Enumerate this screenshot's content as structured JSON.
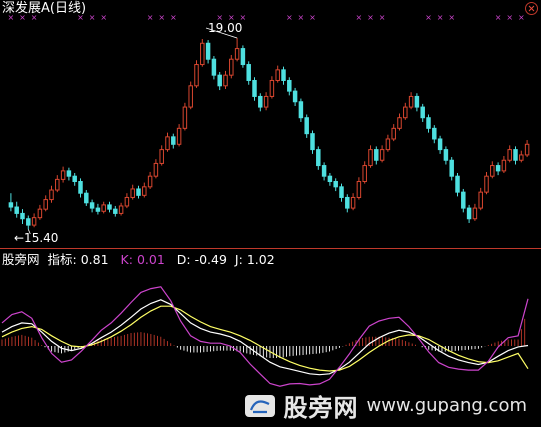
{
  "header": {
    "symbol": "深发展A",
    "period": "(日线)",
    "high_label": "19.00",
    "low_label": "←15.40"
  },
  "indicator": {
    "name": "股旁网",
    "metric_label": "指标:",
    "metric_value": "0.81",
    "k_label": "K:",
    "k_value": "0.01",
    "d_label": "D:",
    "d_value": "-0.49",
    "j_label": "J:",
    "j_value": "1.02"
  },
  "watermark": {
    "cn": "股旁网",
    "url": "www.gupang.com"
  },
  "colors": {
    "up": "#d8462f",
    "down": "#4fe0e0",
    "k_line": "#ffffff",
    "d_line": "#ffff66",
    "j_line": "#cc44cc",
    "marker": "#cc44cc",
    "divider": "#c0392b"
  },
  "chart_data": [
    {
      "type": "candlestick",
      "title": "深发展A (日线)",
      "ylim": [
        15.2,
        19.3
      ],
      "annotations": [
        {
          "label": "19.00",
          "index": 39,
          "value": 19.0
        },
        {
          "label": "←15.40",
          "index": 3,
          "value": 15.4
        }
      ],
      "candles": [
        [
          15.9,
          15.82,
          16.08,
          15.74
        ],
        [
          15.82,
          15.7,
          15.92,
          15.62
        ],
        [
          15.7,
          15.6,
          15.78,
          15.5
        ],
        [
          15.6,
          15.48,
          15.66,
          15.4
        ],
        [
          15.48,
          15.62,
          15.7,
          15.44
        ],
        [
          15.62,
          15.78,
          15.86,
          15.58
        ],
        [
          15.78,
          15.96,
          16.04,
          15.74
        ],
        [
          15.96,
          16.14,
          16.22,
          15.9
        ],
        [
          16.14,
          16.34,
          16.42,
          16.1
        ],
        [
          16.34,
          16.5,
          16.58,
          16.28
        ],
        [
          16.5,
          16.4,
          16.56,
          16.32
        ],
        [
          16.4,
          16.3,
          16.46,
          16.22
        ],
        [
          16.3,
          16.08,
          16.36,
          16.0
        ],
        [
          16.08,
          15.9,
          16.14,
          15.84
        ],
        [
          15.9,
          15.8,
          15.96,
          15.72
        ],
        [
          15.8,
          15.74,
          15.88,
          15.68
        ],
        [
          15.74,
          15.86,
          15.92,
          15.7
        ],
        [
          15.86,
          15.78,
          15.92,
          15.72
        ],
        [
          15.78,
          15.7,
          15.84,
          15.64
        ],
        [
          15.7,
          15.84,
          15.9,
          15.66
        ],
        [
          15.84,
          16.0,
          16.08,
          15.8
        ],
        [
          16.0,
          16.16,
          16.24,
          15.96
        ],
        [
          16.16,
          16.04,
          16.22,
          15.98
        ],
        [
          16.04,
          16.2,
          16.28,
          16.0
        ],
        [
          16.2,
          16.4,
          16.48,
          16.16
        ],
        [
          16.4,
          16.64,
          16.72,
          16.36
        ],
        [
          16.64,
          16.9,
          16.98,
          16.6
        ],
        [
          16.9,
          17.14,
          17.22,
          16.86
        ],
        [
          17.14,
          17.0,
          17.2,
          16.92
        ],
        [
          17.0,
          17.3,
          17.38,
          16.96
        ],
        [
          17.3,
          17.7,
          17.78,
          17.26
        ],
        [
          17.7,
          18.1,
          18.18,
          17.66
        ],
        [
          18.1,
          18.5,
          18.58,
          18.06
        ],
        [
          18.5,
          18.9,
          18.98,
          18.46
        ],
        [
          18.9,
          18.6,
          18.96,
          18.52
        ],
        [
          18.6,
          18.3,
          18.66,
          18.22
        ],
        [
          18.3,
          18.1,
          18.36,
          18.02
        ],
        [
          18.1,
          18.3,
          18.38,
          18.04
        ],
        [
          18.3,
          18.6,
          18.68,
          18.24
        ],
        [
          18.6,
          18.8,
          19.0,
          18.56
        ],
        [
          18.8,
          18.5,
          18.86,
          18.44
        ],
        [
          18.5,
          18.2,
          18.56,
          18.12
        ],
        [
          18.2,
          17.9,
          18.26,
          17.82
        ],
        [
          17.9,
          17.7,
          17.96,
          17.62
        ],
        [
          17.7,
          17.9,
          17.98,
          17.64
        ],
        [
          17.9,
          18.2,
          18.28,
          17.86
        ],
        [
          18.2,
          18.4,
          18.48,
          18.16
        ],
        [
          18.4,
          18.2,
          18.46,
          18.12
        ],
        [
          18.2,
          18.0,
          18.26,
          17.92
        ],
        [
          18.0,
          17.8,
          18.06,
          17.72
        ],
        [
          17.8,
          17.5,
          17.86,
          17.42
        ],
        [
          17.5,
          17.2,
          17.56,
          17.12
        ],
        [
          17.2,
          16.9,
          17.26,
          16.82
        ],
        [
          16.9,
          16.6,
          16.96,
          16.52
        ],
        [
          16.6,
          16.4,
          16.66,
          16.32
        ],
        [
          16.4,
          16.3,
          16.46,
          16.22
        ],
        [
          16.3,
          16.2,
          16.36,
          16.12
        ],
        [
          16.2,
          16.0,
          16.26,
          15.92
        ],
        [
          16.0,
          15.8,
          16.06,
          15.72
        ],
        [
          15.8,
          16.0,
          16.08,
          15.76
        ],
        [
          16.0,
          16.3,
          16.38,
          15.96
        ],
        [
          16.3,
          16.6,
          16.68,
          16.26
        ],
        [
          16.6,
          16.9,
          16.98,
          16.56
        ],
        [
          16.9,
          16.7,
          16.96,
          16.62
        ],
        [
          16.7,
          16.9,
          16.98,
          16.66
        ],
        [
          16.9,
          17.1,
          17.18,
          16.86
        ],
        [
          17.1,
          17.3,
          17.38,
          17.06
        ],
        [
          17.3,
          17.5,
          17.58,
          17.26
        ],
        [
          17.5,
          17.7,
          17.78,
          17.46
        ],
        [
          17.7,
          17.9,
          17.98,
          17.66
        ],
        [
          17.9,
          17.7,
          17.96,
          17.62
        ],
        [
          17.7,
          17.5,
          17.76,
          17.42
        ],
        [
          17.5,
          17.3,
          17.56,
          17.22
        ],
        [
          17.3,
          17.1,
          17.36,
          17.02
        ],
        [
          17.1,
          16.9,
          17.16,
          16.82
        ],
        [
          16.9,
          16.7,
          16.96,
          16.62
        ],
        [
          16.7,
          16.4,
          16.76,
          16.32
        ],
        [
          16.4,
          16.1,
          16.46,
          16.02
        ],
        [
          16.1,
          15.8,
          16.16,
          15.72
        ],
        [
          15.8,
          15.6,
          15.86,
          15.52
        ],
        [
          15.6,
          15.8,
          15.88,
          15.56
        ],
        [
          15.8,
          16.1,
          16.18,
          15.76
        ],
        [
          16.1,
          16.4,
          16.48,
          16.06
        ],
        [
          16.4,
          16.6,
          16.68,
          16.36
        ],
        [
          16.6,
          16.5,
          16.66,
          16.42
        ],
        [
          16.5,
          16.7,
          16.78,
          16.46
        ],
        [
          16.7,
          16.9,
          16.98,
          16.66
        ],
        [
          16.9,
          16.7,
          16.96,
          16.62
        ],
        [
          16.7,
          16.8,
          16.88,
          16.66
        ],
        [
          16.8,
          17.0,
          17.08,
          16.76
        ]
      ]
    },
    {
      "type": "line",
      "title": "股旁网 指标",
      "ylim": [
        -1.6,
        1.6
      ],
      "series": [
        {
          "name": "K",
          "values": [
            0.3,
            0.42,
            0.5,
            0.48,
            0.3,
            0.1,
            -0.05,
            -0.1,
            -0.05,
            0.05,
            0.18,
            0.3,
            0.45,
            0.62,
            0.8,
            0.92,
            1.0,
            0.9,
            0.7,
            0.5,
            0.38,
            0.3,
            0.26,
            0.2,
            0.1,
            -0.05,
            -0.2,
            -0.35,
            -0.45,
            -0.5,
            -0.55,
            -0.6,
            -0.62,
            -0.6,
            -0.5,
            -0.35,
            -0.15,
            0.05,
            0.18,
            0.28,
            0.34,
            0.3,
            0.2,
            0.05,
            -0.1,
            -0.22,
            -0.3,
            -0.36,
            -0.4,
            -0.35,
            -0.22,
            -0.1,
            -0.02,
            0.01
          ]
        },
        {
          "name": "D",
          "values": [
            0.2,
            0.3,
            0.38,
            0.42,
            0.36,
            0.22,
            0.1,
            0.0,
            -0.02,
            0.02,
            0.1,
            0.2,
            0.32,
            0.46,
            0.62,
            0.76,
            0.86,
            0.86,
            0.78,
            0.64,
            0.52,
            0.42,
            0.36,
            0.3,
            0.22,
            0.12,
            0.0,
            -0.12,
            -0.24,
            -0.34,
            -0.42,
            -0.48,
            -0.52,
            -0.54,
            -0.52,
            -0.44,
            -0.3,
            -0.14,
            0.0,
            0.12,
            0.2,
            0.24,
            0.22,
            0.14,
            0.02,
            -0.1,
            -0.2,
            -0.28,
            -0.34,
            -0.36,
            -0.32,
            -0.24,
            -0.16,
            -0.49
          ]
        },
        {
          "name": "J",
          "values": [
            0.5,
            0.68,
            0.74,
            0.6,
            0.18,
            -0.16,
            -0.35,
            -0.3,
            -0.11,
            0.11,
            0.34,
            0.5,
            0.71,
            0.94,
            1.16,
            1.24,
            1.28,
            0.98,
            0.54,
            0.22,
            0.1,
            0.06,
            0.06,
            0.0,
            -0.14,
            -0.39,
            -0.6,
            -0.81,
            -0.87,
            -0.82,
            -0.81,
            -0.84,
            -0.82,
            -0.72,
            -0.46,
            -0.17,
            0.15,
            0.43,
            0.54,
            0.6,
            0.62,
            0.42,
            0.16,
            -0.13,
            -0.36,
            -0.46,
            -0.5,
            -0.52,
            -0.52,
            -0.33,
            -0.02,
            0.18,
            0.22,
            1.02
          ]
        }
      ],
      "histogram": [
        0.14,
        0.2,
        0.24,
        0.18,
        0.02,
        -0.12,
        -0.16,
        -0.1,
        -0.02,
        0.06,
        0.14,
        0.18,
        0.22,
        0.28,
        0.3,
        0.26,
        0.2,
        0.06,
        -0.08,
        -0.14,
        -0.14,
        -0.12,
        -0.1,
        -0.1,
        -0.12,
        -0.18,
        -0.22,
        -0.26,
        -0.26,
        -0.22,
        -0.2,
        -0.18,
        -0.16,
        -0.12,
        -0.04,
        0.06,
        0.16,
        0.2,
        0.2,
        0.18,
        0.16,
        0.08,
        0.0,
        -0.08,
        -0.12,
        -0.12,
        -0.1,
        -0.08,
        -0.06,
        0.02,
        0.1,
        0.14,
        0.14,
        0.81
      ]
    }
  ]
}
